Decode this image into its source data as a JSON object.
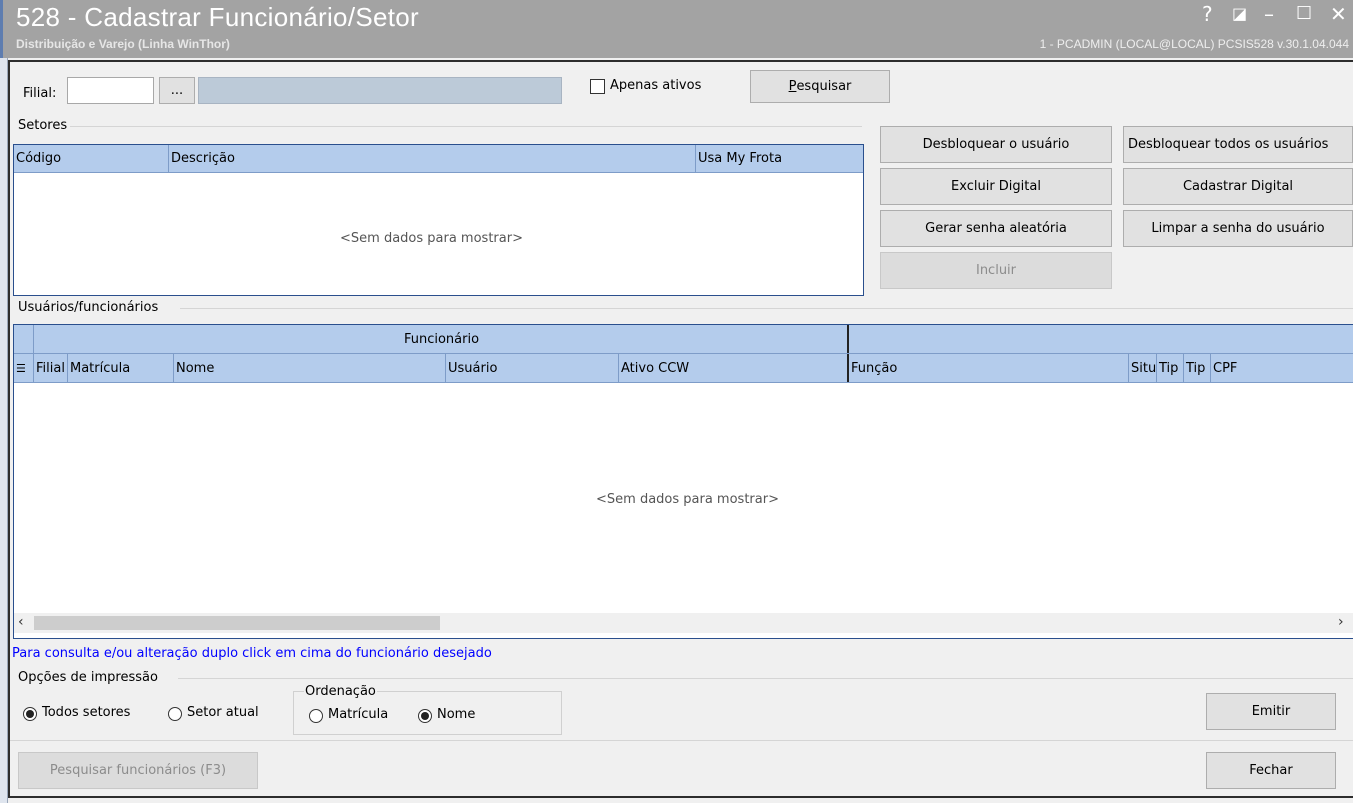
{
  "window": {
    "title": "528 - Cadastrar Funcionário/Setor",
    "subtitle": "Distribuição e Varejo (Linha WinThor)",
    "user_info": "1 - PCADMIN (LOCAL@LOCAL)   PCSIS528  v.30.1.04.044",
    "controls": {
      "help": "?",
      "restore": "◪",
      "minimize": "–",
      "maximize": "☐",
      "close": "✕"
    }
  },
  "filter": {
    "filial_label": "Filial:",
    "filial_value": "",
    "browse_label": "...",
    "filial_desc": "",
    "apenas_ativos_label": "Apenas ativos",
    "apenas_ativos_checked": false,
    "pesquisar_label": "Pesquisar",
    "pesquisar_underline": "P"
  },
  "setores": {
    "group_label": "Setores",
    "columns": [
      "Código",
      "Descrição",
      "Usa My Frota"
    ],
    "empty_text": "<Sem dados para mostrar>"
  },
  "actions": {
    "desbloquear": "Desbloquear o usuário",
    "desbloquear_todos": "Desbloquear todos os usuários",
    "excluir_digital": "Excluir Digital",
    "cadastrar_digital": "Cadastrar Digital",
    "gerar_senha": "Gerar senha aleatória",
    "limpar_senha": "Limpar a senha do usuário",
    "incluir": "Incluir"
  },
  "usuarios": {
    "group_label": "Usuários/funcionários",
    "band_label": "Funcionário",
    "columns": [
      "Filial",
      "Matrícula",
      "Nome",
      "Usuário",
      "Ativo CCW",
      "Função",
      "Situ",
      "Tip",
      "Tip",
      "CPF"
    ],
    "empty_text": "<Sem dados para mostrar>"
  },
  "hint_text": "Para consulta e/ou alteração duplo click em cima do funcionário desejado",
  "impressao": {
    "group_label": "Opções de impressão",
    "todos_setores": "Todos setores",
    "setor_atual": "Setor atual",
    "selected": "Todos setores",
    "ordenacao_label": "Ordenação",
    "matricula": "Matrícula",
    "nome": "Nome",
    "ordenacao_selected": "Nome"
  },
  "footer": {
    "emitir": "Emitir",
    "pesquisar_funcionarios": "Pesquisar funcionários (F3)",
    "fechar": "Fechar"
  },
  "colors": {
    "titlebar": "#a3a3a3",
    "grid_header": "#b4ccec",
    "grid_border": "#2a4f8d",
    "hint_text": "#0000ff"
  }
}
